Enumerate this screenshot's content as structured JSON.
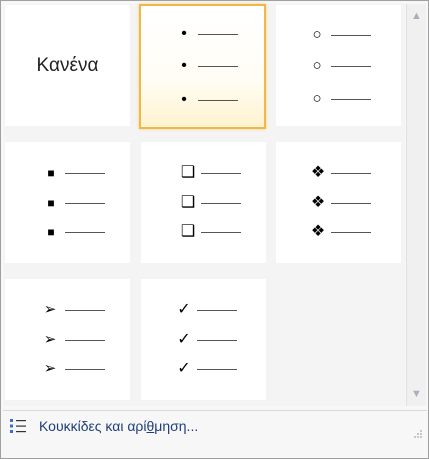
{
  "gallery": {
    "none_label": "Κανένα",
    "selected_index": 1,
    "cells": [
      {
        "id": "none",
        "glyph": ""
      },
      {
        "id": "filled-round",
        "glyph": "•"
      },
      {
        "id": "hollow-round",
        "glyph": "○"
      },
      {
        "id": "filled-square",
        "glyph": "■"
      },
      {
        "id": "hollow-square",
        "glyph": "❑"
      },
      {
        "id": "four-diamond",
        "glyph": "❖"
      },
      {
        "id": "arrow",
        "glyph": "➢"
      },
      {
        "id": "checkmark",
        "glyph": "✓"
      }
    ]
  },
  "scrollbar": {
    "up_icon": "▲",
    "down_icon": "▼"
  },
  "footer": {
    "label": "Κουκκίδες και αρί_θμηση...",
    "icon": "bullet-list-icon"
  },
  "colors": {
    "selected_border": "#f0b84a",
    "footer_text": "#1e3d7b"
  }
}
